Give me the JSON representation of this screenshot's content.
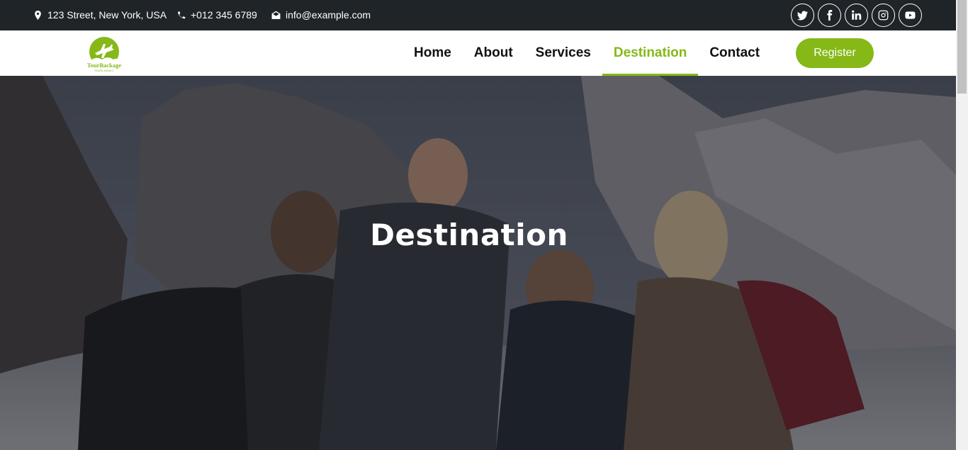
{
  "topbar": {
    "address": "123 Street, New York, USA",
    "phone": "+012 345 6789",
    "email": "info@example.com"
  },
  "socials": [
    "twitter-icon",
    "facebook-icon",
    "linkedin-icon",
    "instagram-icon",
    "youtube-icon"
  ],
  "logo": {
    "text": "TourBackage",
    "tagline": "TRAVEL AGENCY"
  },
  "nav": {
    "links": [
      "Home",
      "About",
      "Services",
      "Destination",
      "Contact"
    ],
    "active": "Destination",
    "register_label": "Register"
  },
  "hero": {
    "title": "Destination"
  },
  "colors": {
    "accent": "#86b817",
    "topbar": "#1f2428"
  }
}
